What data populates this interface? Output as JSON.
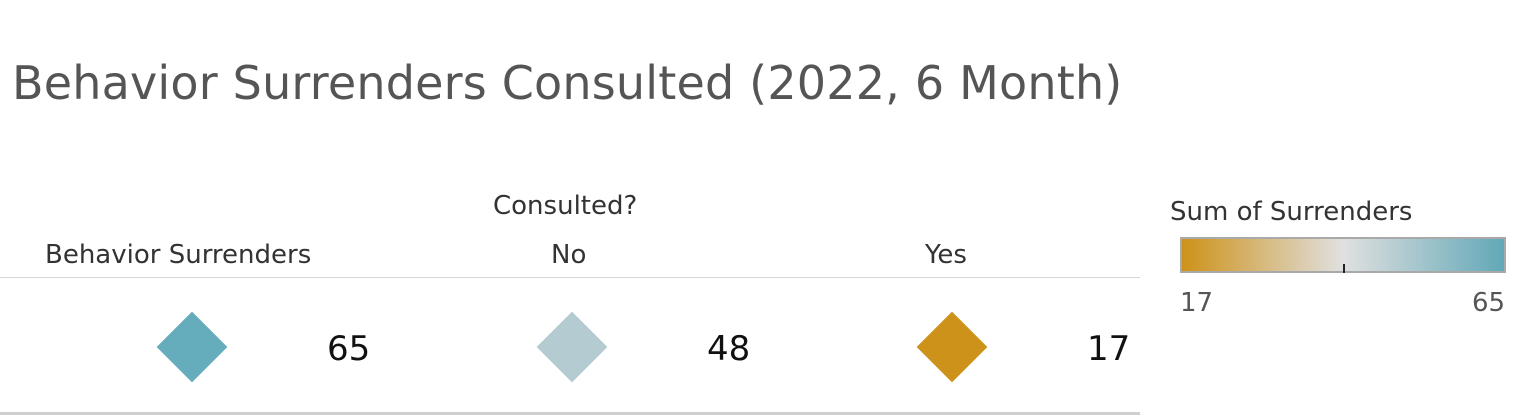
{
  "chart_data": {
    "type": "table",
    "title": "Behavior Surrenders Consulted (2022, 6 Month)",
    "column_group_label": "Consulted?",
    "columns": [
      "Behavior Surrenders",
      "No",
      "Yes"
    ],
    "values": [
      65,
      48,
      17
    ],
    "value_labels": [
      "65",
      "48",
      "17"
    ],
    "mark_colors": [
      "#65acbd",
      "#b5cbd2",
      "#cd9219"
    ],
    "legend": {
      "title": "Sum of Surrenders",
      "min": 17,
      "max": 65,
      "min_label": "17",
      "max_label": "65",
      "colors": [
        "#cd9219",
        "#e0e0e0",
        "#62a8b7"
      ],
      "placement": "right"
    }
  }
}
